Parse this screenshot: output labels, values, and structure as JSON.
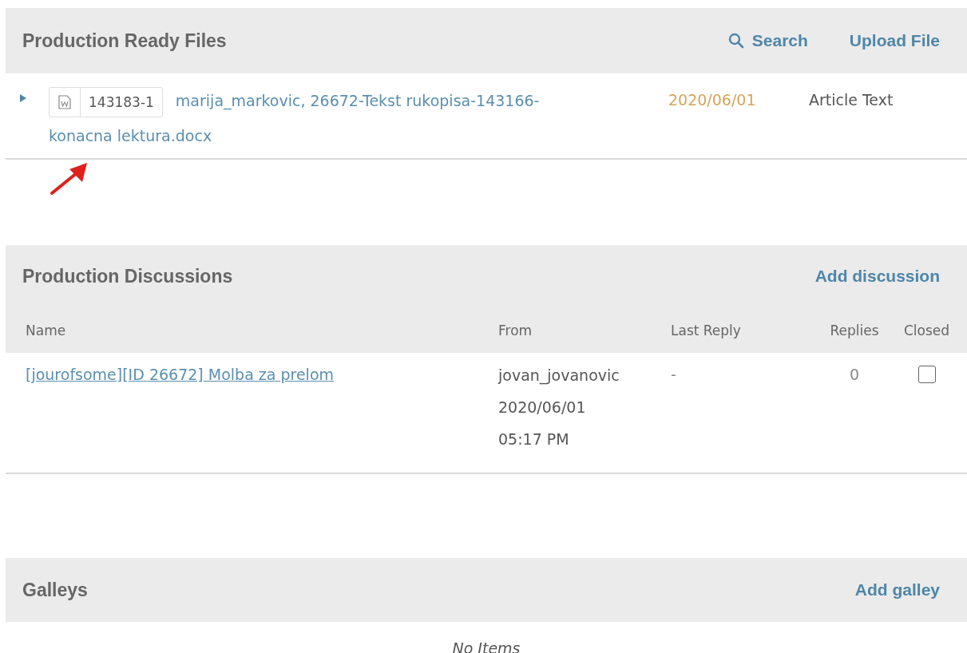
{
  "files_section": {
    "title": "Production Ready Files",
    "actions": [
      {
        "label": "Search",
        "kind": "search"
      },
      {
        "label": "Upload File",
        "kind": "link"
      }
    ],
    "files": [
      {
        "expanded": false,
        "id": "143183-1",
        "name_lines": [
          "marija_markovic, 26672-Tekst rukopisa-143166-",
          "konacna lektura.docx"
        ],
        "date": "2020/06/01",
        "type": "Article Text"
      }
    ]
  },
  "discussions_section": {
    "title": "Production Discussions",
    "actions": [
      {
        "label": "Add discussion"
      }
    ],
    "columns": [
      "Name",
      "From",
      "Last Reply",
      "Replies",
      "Closed"
    ],
    "rows": [
      {
        "name": "[jourofsome][ID 26672] Molba za prelom",
        "from": [
          "jovan_jovanovic",
          "2020/06/01",
          "05:17 PM"
        ],
        "last_reply": "-",
        "replies": "0",
        "closed": false
      }
    ]
  },
  "galleys_section": {
    "title": "Galleys",
    "actions": [
      {
        "label": "Add galley"
      }
    ],
    "empty_text": "No Items"
  }
}
